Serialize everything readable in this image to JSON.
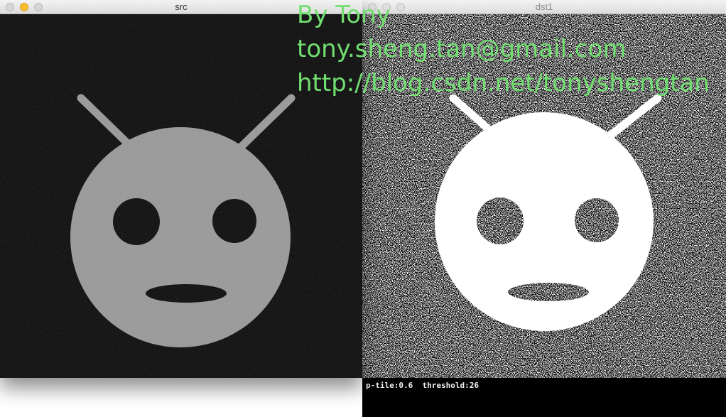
{
  "windows": {
    "src": {
      "title": "src"
    },
    "dst": {
      "title": "dst1",
      "status": {
        "ptile_label": "p-tile:",
        "ptile_value": "0.6",
        "threshold_label": "threshold:",
        "threshold_value": "26"
      }
    }
  },
  "overlay": {
    "line1": "By Tony",
    "line2": "tony.sheng.tan@gmail.com",
    "line3": "http://blog.csdn.net/tonyshengtan"
  },
  "colors": {
    "overlay_text": "#71de70",
    "src_background": "#141414",
    "src_face": "#9a9a9a",
    "dst_face": "#ffffff",
    "close_button": "#d6d6d6",
    "minimize_button": "#f8bd2d"
  },
  "icons": {
    "src_image": "android-face-icon",
    "dst_image": "binarized-android-face-icon"
  }
}
